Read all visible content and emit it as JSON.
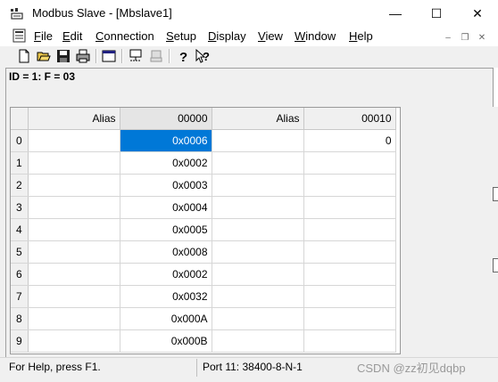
{
  "window": {
    "title": "Modbus Slave - [Mbslave1]",
    "minimize_glyph": "—",
    "maximize_glyph": "☐",
    "close_glyph": "✕"
  },
  "menu": {
    "items": [
      {
        "key": "F",
        "rest": "ile"
      },
      {
        "key": "E",
        "rest": "dit"
      },
      {
        "key": "C",
        "rest": "onnection"
      },
      {
        "key": "S",
        "rest": "etup"
      },
      {
        "key": "D",
        "rest": "isplay"
      },
      {
        "key": "V",
        "rest": "iew"
      },
      {
        "key": "W",
        "rest": "indow"
      },
      {
        "key": "H",
        "rest": "elp"
      }
    ]
  },
  "mdi": {
    "minimize_glyph": "–",
    "restore_glyph": "❐",
    "close_glyph": "✕"
  },
  "toolbar": {
    "icons": [
      "new-icon",
      "open-icon",
      "save-icon",
      "print-icon",
      "window-icon",
      "connect-icon",
      "disconnect-icon",
      "help-icon",
      "context-help-icon"
    ]
  },
  "slave": {
    "id_line": "ID = 1: F = 03"
  },
  "grid": {
    "headers": [
      "Alias",
      "00000",
      "Alias",
      "00010"
    ],
    "rows": [
      {
        "num": "0",
        "alias1": "",
        "val1": "0x0006",
        "alias2": "",
        "val2": "0"
      },
      {
        "num": "1",
        "alias1": "",
        "val1": "0x0002",
        "alias2": "",
        "val2": ""
      },
      {
        "num": "2",
        "alias1": "",
        "val1": "0x0003",
        "alias2": "",
        "val2": ""
      },
      {
        "num": "3",
        "alias1": "",
        "val1": "0x0004",
        "alias2": "",
        "val2": ""
      },
      {
        "num": "4",
        "alias1": "",
        "val1": "0x0005",
        "alias2": "",
        "val2": ""
      },
      {
        "num": "5",
        "alias1": "",
        "val1": "0x0008",
        "alias2": "",
        "val2": ""
      },
      {
        "num": "6",
        "alias1": "",
        "val1": "0x0002",
        "alias2": "",
        "val2": ""
      },
      {
        "num": "7",
        "alias1": "",
        "val1": "0x0032",
        "alias2": "",
        "val2": ""
      },
      {
        "num": "8",
        "alias1": "",
        "val1": "0x000A",
        "alias2": "",
        "val2": ""
      },
      {
        "num": "9",
        "alias1": "",
        "val1": "0x000B",
        "alias2": "",
        "val2": ""
      }
    ]
  },
  "status": {
    "help_text": "For Help, press F1.",
    "port_text": "Port 11: 38400-8-N-1"
  },
  "watermark": "CSDN @zz初见dqbp",
  "colors": {
    "selection": "#0078d7",
    "header_bg": "#f0f0f0",
    "grid_line": "#d6d6d6"
  }
}
